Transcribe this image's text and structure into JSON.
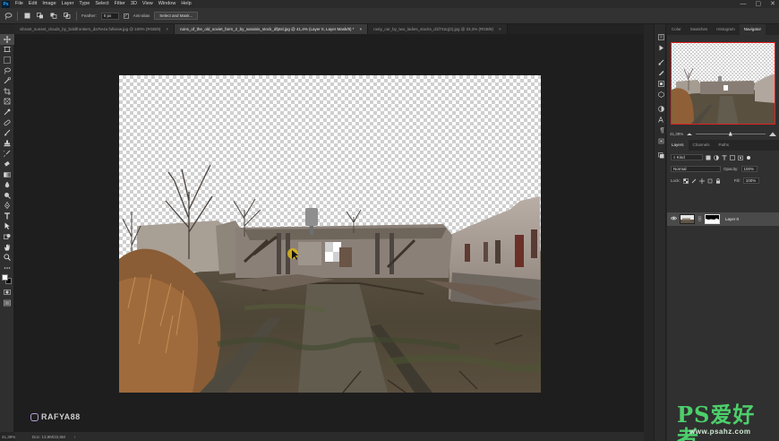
{
  "app": {
    "logo_text": "Ps"
  },
  "menu": {
    "items": [
      "File",
      "Edit",
      "Image",
      "Layer",
      "Type",
      "Select",
      "Filter",
      "3D",
      "View",
      "Window",
      "Help"
    ]
  },
  "window_controls": {
    "minimize": "—",
    "maximize": "▢",
    "close": "✕"
  },
  "options_bar": {
    "feather_label": "Feather:",
    "feather_value": "0 px",
    "anti_alias_label": "Anti-alias",
    "anti_alias_checked": "✓",
    "select_mask_label": "Select and Mask..."
  },
  "tabs": [
    {
      "label": "vibrant_sunset_clouds_by_boldfrontiers_da7te4a fullview.jpg @ 100% (RGB/8)",
      "close": "×",
      "active": false
    },
    {
      "label": "ruins_of_the_old_soviet_farm_2_by_sarainis_stock_dfptsl.jpg @ 41,4% (Layer 0, Layer Mask/8) *",
      "close": "×",
      "active": true
    },
    {
      "label": "rusty_car_by_two_ladies_stocks_d1f742q(2).jpg @ 33,3% (RGB/8)",
      "close": "×",
      "active": false
    }
  ],
  "tools": [
    "move-icon",
    "artboard-icon",
    "marquee-icon",
    "lasso-icon",
    "quick-select-icon",
    "crop-icon",
    "frame-icon",
    "eyedropper-icon",
    "healing-icon",
    "brush-icon",
    "stamp-icon",
    "history-brush-icon",
    "eraser-icon",
    "gradient-icon",
    "blur-icon",
    "dodge-icon",
    "pen-icon",
    "type-icon",
    "path-select-icon",
    "shape-icon",
    "hand-icon",
    "zoom-icon",
    "more-icon"
  ],
  "watermark": {
    "handle": "RAFYA88"
  },
  "status": {
    "zoom": "41,39%",
    "doc": "Doc: 13,9M/22,6M",
    "arrow": "›"
  },
  "right_panel": {
    "top_tabs": [
      "Color",
      "Swatches",
      "Histogram",
      "Navigator"
    ],
    "active_top_tab": "Navigator",
    "nav_zoom": "41,39%",
    "nav_zoom_fraction": 0.47,
    "layer_tabs": [
      "Layers",
      "Channels",
      "Paths"
    ],
    "active_layer_tab": "Layers",
    "kind_label": "Kind",
    "blend_mode": "Normal",
    "opacity_label": "Opacity:",
    "opacity_value": "100%",
    "lock_label": "Lock:",
    "fill_label": "Fill:",
    "fill_value": "100%",
    "layer_name": "Layer 0"
  },
  "site_watermark": {
    "brand": "PS爱好者",
    "url": "www.psahz.com"
  },
  "colors": {
    "nav_frame": "#e0221f",
    "brand_green": "#4ccf6b"
  }
}
